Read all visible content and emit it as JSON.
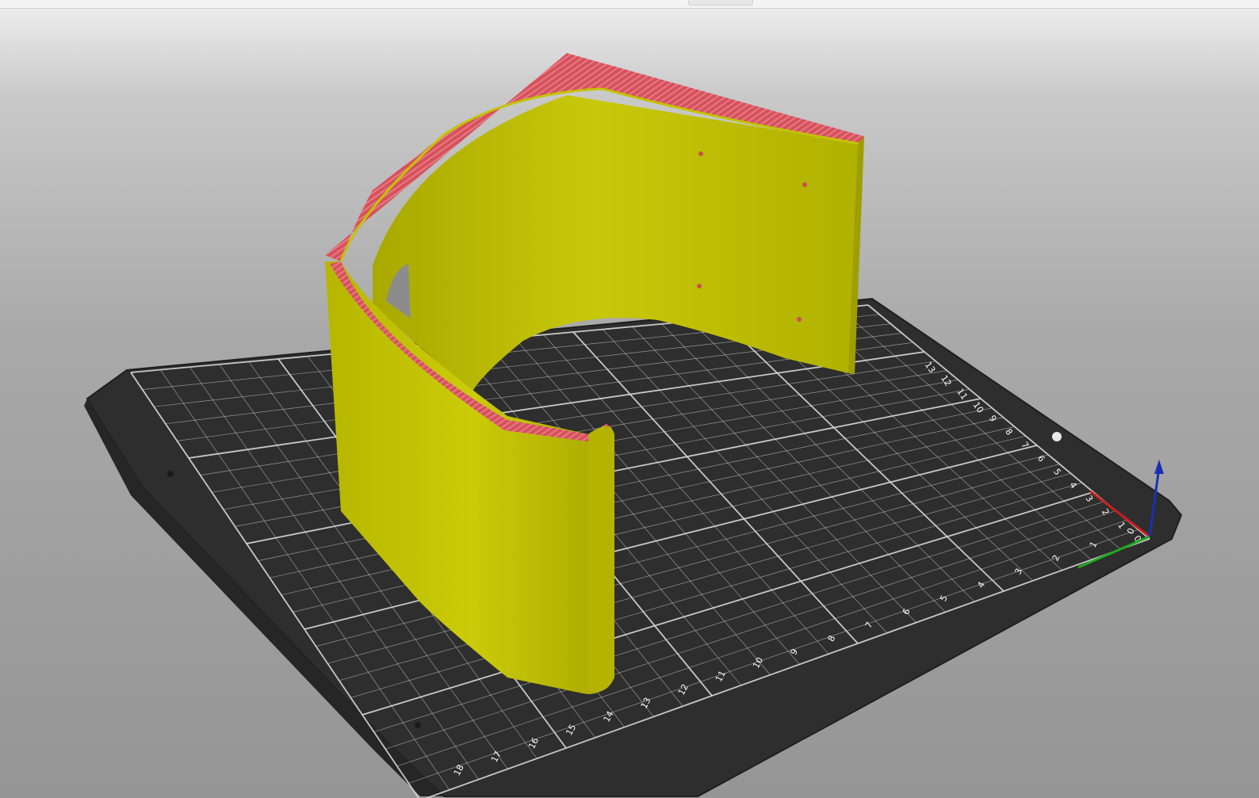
{
  "scene": {
    "bed_color": "#2e2e2e",
    "grid_color": "#d9d9d9",
    "part_color": "#c9c900",
    "infill_color": "#d9505a",
    "axis_colors": {
      "x": "#c81e1e",
      "y": "#1fa81f",
      "z": "#1a2fb4"
    }
  },
  "bed_labels": {
    "right_edge": [
      "0",
      "1",
      "2",
      "3",
      "4",
      "5",
      "6",
      "7",
      "8",
      "9",
      "10",
      "11",
      "12",
      "13"
    ],
    "front_edge": [
      "0",
      "1",
      "2",
      "3",
      "4",
      "5",
      "6",
      "7",
      "8",
      "9",
      "10",
      "11",
      "12",
      "13",
      "14",
      "15",
      "16",
      "17",
      "18"
    ]
  },
  "icons": {
    "axes": "xyz-axes-icon",
    "bed_hole": "bed-mount-hole-icon"
  }
}
